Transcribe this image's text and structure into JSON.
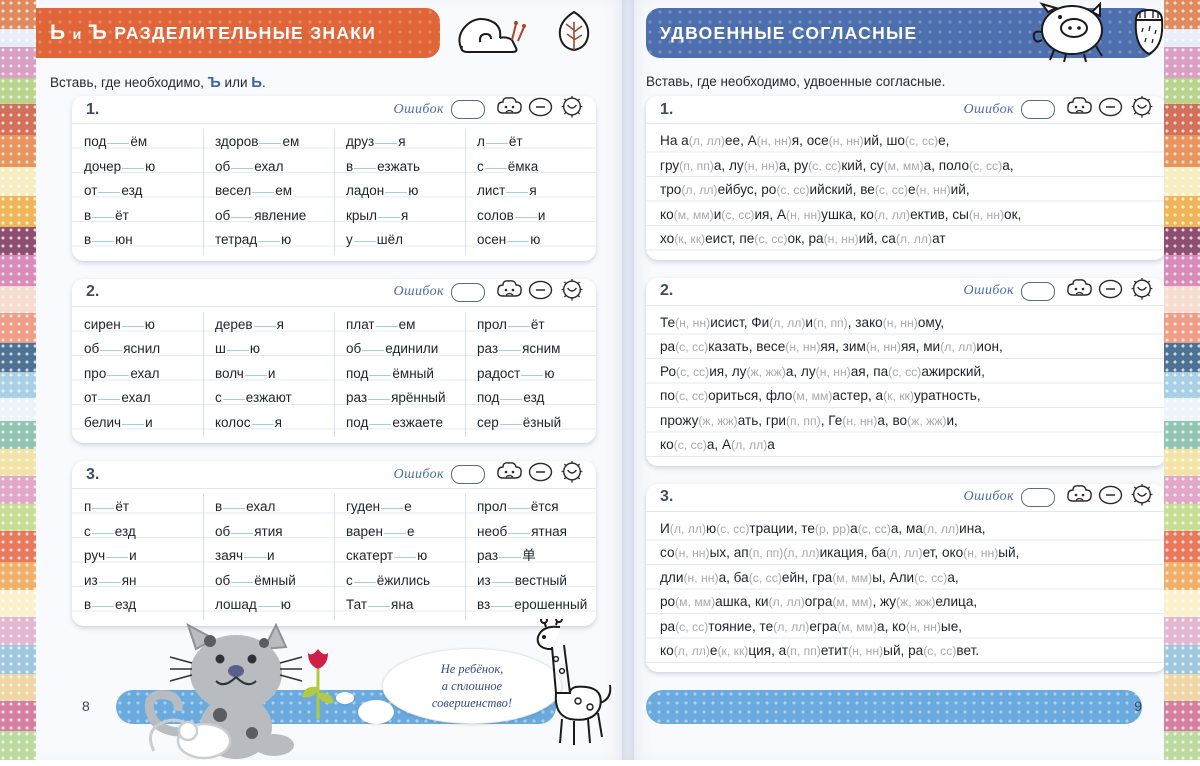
{
  "colors": {
    "left_banner": "#e0663a",
    "right_banner": "#4e6fae",
    "footer_bar": "#6aaade",
    "gap_underline": "#9fd0dd",
    "option_gray": "#a8a8ac",
    "accent_blue": "#3a63a8"
  },
  "border_bands": [
    {
      "color": "#e08a5e",
      "h": 28
    },
    {
      "color": "#e8eef7",
      "h": 18
    },
    {
      "color": "#d9a0c4",
      "h": 30
    },
    {
      "color": "#b9d48c",
      "h": 26
    },
    {
      "color": "#d4705a",
      "h": 30
    },
    {
      "color": "#e8945c",
      "h": 32
    },
    {
      "color": "#f7eec2",
      "h": 28
    },
    {
      "color": "#eeb659",
      "h": 30
    },
    {
      "color": "#8e5070",
      "h": 28
    },
    {
      "color": "#d98cba",
      "h": 30
    },
    {
      "color": "#f6ddd0",
      "h": 26
    },
    {
      "color": "#ef9d86",
      "h": 30
    },
    {
      "color": "#4c7193",
      "h": 28
    },
    {
      "color": "#a8cfe4",
      "h": 26
    },
    {
      "color": "#eef3f9",
      "h": 22
    },
    {
      "color": "#93c3b2",
      "h": 28
    },
    {
      "color": "#f3e3a8",
      "h": 26
    },
    {
      "color": "#e0a7c6",
      "h": 28
    },
    {
      "color": "#c9dd95",
      "h": 26
    },
    {
      "color": "#e8795c",
      "h": 30
    },
    {
      "color": "#f1b06a",
      "h": 28
    },
    {
      "color": "#fbf1cd",
      "h": 26
    },
    {
      "color": "#e3b7cf",
      "h": 28
    },
    {
      "color": "#9fc7e0",
      "h": 28
    },
    {
      "color": "#f0d6a6",
      "h": 26
    },
    {
      "color": "#d47f9f",
      "h": 30
    },
    {
      "color": "#bcd9a0",
      "h": 28
    }
  ],
  "left_page": {
    "banner": {
      "prefix": "Ь",
      "conj": "и",
      "prefix2": "Ъ",
      "title": "РАЗДЕЛИТЕЛЬНЫЕ ЗНАКИ",
      "icons": [
        "snail-icon",
        "leaf-icon"
      ]
    },
    "instruction": {
      "pre": "Вставь, где необходимо, ",
      "b1": "Ъ",
      "mid": " или ",
      "b2": "Ь",
      "post": "."
    },
    "error_label": "Ошибок",
    "mood_icons": [
      "sad-cloud-icon",
      "neutral-face-icon",
      "happy-sun-icon"
    ],
    "page_number": "8",
    "exercises": [
      {
        "num": "1.",
        "columns": [
          [
            {
              "a": "под",
              "b": "ём"
            },
            {
              "a": "дочер",
              "b": "ю"
            },
            {
              "a": "от",
              "b": "езд"
            },
            {
              "a": "в",
              "b": "ёт"
            },
            {
              "a": "в",
              "b": "юн"
            }
          ],
          [
            {
              "a": "здоров",
              "b": "ем"
            },
            {
              "a": "об",
              "b": "ехал"
            },
            {
              "a": "весел",
              "b": "ем"
            },
            {
              "a": "об",
              "b": "явление"
            },
            {
              "a": "тетрад",
              "b": "ю"
            }
          ],
          [
            {
              "a": "друз",
              "b": "я"
            },
            {
              "a": "в",
              "b": "езжать"
            },
            {
              "a": "ладон",
              "b": "ю"
            },
            {
              "a": "крыл",
              "b": "я"
            },
            {
              "a": "у",
              "b": "шёл"
            }
          ],
          [
            {
              "a": "л",
              "b": "ёт"
            },
            {
              "a": "с",
              "b": "ёмка"
            },
            {
              "a": "лист",
              "b": "я"
            },
            {
              "a": "солов",
              "b": "и"
            },
            {
              "a": "осен",
              "b": "ю"
            }
          ]
        ]
      },
      {
        "num": "2.",
        "columns": [
          [
            {
              "a": "сирен",
              "b": "ю"
            },
            {
              "a": "об",
              "b": "яснил"
            },
            {
              "a": "про",
              "b": "ехал"
            },
            {
              "a": "от",
              "b": "ехал"
            },
            {
              "a": "белич",
              "b": "и"
            }
          ],
          [
            {
              "a": "дерев",
              "b": "я"
            },
            {
              "a": "ш",
              "b": "ю"
            },
            {
              "a": "волч",
              "b": "и"
            },
            {
              "a": "с",
              "b": "езжают"
            },
            {
              "a": "колос",
              "b": "я"
            }
          ],
          [
            {
              "a": "плат",
              "b": "ем"
            },
            {
              "a": "об",
              "b": "единили"
            },
            {
              "a": "под",
              "b": "ёмный"
            },
            {
              "a": "раз",
              "b": "ярённый"
            },
            {
              "a": "под",
              "b": "езжаете"
            }
          ],
          [
            {
              "a": "прол",
              "b": "ёт"
            },
            {
              "a": "раз",
              "b": "ясним"
            },
            {
              "a": "радост",
              "b": "ю"
            },
            {
              "a": "под",
              "b": "езд"
            },
            {
              "a": "сер",
              "b": "ёзный"
            }
          ]
        ]
      },
      {
        "num": "3.",
        "columns": [
          [
            {
              "a": "п",
              "b": "ёт"
            },
            {
              "a": "с",
              "b": "езд"
            },
            {
              "a": "руч",
              "b": "и"
            },
            {
              "a": "из",
              "b": "ян"
            },
            {
              "a": "в",
              "b": "езд"
            }
          ],
          [
            {
              "a": "в",
              "b": "ехал"
            },
            {
              "a": "об",
              "b": "ятия"
            },
            {
              "a": "заяч",
              "b": "и"
            },
            {
              "a": "об",
              "b": "ёмный"
            },
            {
              "a": "лошад",
              "b": "ю"
            }
          ],
          [
            {
              "a": "гуден",
              "b": "е"
            },
            {
              "a": "варен",
              "b": "е"
            },
            {
              "a": "скатерт",
              "b": "ю"
            },
            {
              "a": "с",
              "b": "ёжились"
            },
            {
              "a": "Тат",
              "b": "яна"
            }
          ],
          [
            {
              "a": "прол",
              "b": "ётся"
            },
            {
              "a": "необ",
              "b": "ятная"
            },
            {
              "a": "раз",
              "b": "单"
            },
            {
              "a": "из",
              "b": "вестный"
            },
            {
              "a": "вз",
              "b": "ерошенный"
            }
          ]
        ]
      }
    ],
    "speech_bubble": [
      "Не ребёнок,",
      "а сплошное",
      "совершенство!"
    ],
    "illustrations": [
      "cat-illustration",
      "giraffe-illustration",
      "mouse-illustration",
      "tulip-illustration"
    ]
  },
  "right_page": {
    "banner": {
      "title": "УДВОЕННЫЕ СОГЛАСНЫЕ",
      "icons": [
        "pig-icon",
        "acorn-icon"
      ]
    },
    "instruction": "Вставь, где необходимо, удвоенные согласные.",
    "error_label": "Ошибок",
    "mood_icons": [
      "sad-cloud-icon",
      "neutral-face-icon",
      "happy-sun-icon"
    ],
    "page_number": "9",
    "exercises": [
      {
        "num": "1.",
        "lines": [
          [
            {
              "t": "На а"
            },
            {
              "o": "(л, лл)"
            },
            {
              "t": "ее, А"
            },
            {
              "o": "(н, нн)"
            },
            {
              "t": "я, осе"
            },
            {
              "o": "(н, нн)"
            },
            {
              "t": "ий, шо"
            },
            {
              "o": "(с, сс)"
            },
            {
              "t": "е,"
            }
          ],
          [
            {
              "t": "гру"
            },
            {
              "o": "(п, пп)"
            },
            {
              "t": "а, лу"
            },
            {
              "o": "(н, нн)"
            },
            {
              "t": "а, ру"
            },
            {
              "o": "(с, сс)"
            },
            {
              "t": "кий, су"
            },
            {
              "o": "(м, мм)"
            },
            {
              "t": "а, поло"
            },
            {
              "o": "(с, сс)"
            },
            {
              "t": "а,"
            }
          ],
          [
            {
              "t": "тро"
            },
            {
              "o": "(л, лл)"
            },
            {
              "t": "ейбус, ро"
            },
            {
              "o": "(с, сс)"
            },
            {
              "t": "ийский, ве"
            },
            {
              "o": "(с, сс)"
            },
            {
              "t": "е"
            },
            {
              "o": "(н, нн)"
            },
            {
              "t": "ий,"
            }
          ],
          [
            {
              "t": "ко"
            },
            {
              "o": "(м, мм)"
            },
            {
              "t": "и"
            },
            {
              "o": "(с, сс)"
            },
            {
              "t": "ия, А"
            },
            {
              "o": "(н, нн)"
            },
            {
              "t": "ушка, ко"
            },
            {
              "o": "(л, лл)"
            },
            {
              "t": "ектив, сы"
            },
            {
              "o": "(н, нн)"
            },
            {
              "t": "ок,"
            }
          ],
          [
            {
              "t": "хо"
            },
            {
              "o": "(к, кк)"
            },
            {
              "t": "еист, пе"
            },
            {
              "o": "(с, сс)"
            },
            {
              "t": "ок, ра"
            },
            {
              "o": "(н, нн)"
            },
            {
              "t": "ий, са"
            },
            {
              "o": "(л, лл)"
            },
            {
              "t": "ат"
            }
          ]
        ]
      },
      {
        "num": "2.",
        "lines": [
          [
            {
              "t": "Те"
            },
            {
              "o": "(н, нн)"
            },
            {
              "t": "исист, Фи"
            },
            {
              "o": "(л, лл)"
            },
            {
              "t": "и"
            },
            {
              "o": "(п, пп)"
            },
            {
              "t": ", зако"
            },
            {
              "o": "(н, нн)"
            },
            {
              "t": "ому,"
            }
          ],
          [
            {
              "t": "ра"
            },
            {
              "o": "(с, сс)"
            },
            {
              "t": "казать, весе"
            },
            {
              "o": "(н, нн)"
            },
            {
              "t": "яя, зим"
            },
            {
              "o": "(н, нн)"
            },
            {
              "t": "яя, ми"
            },
            {
              "o": "(л, лл)"
            },
            {
              "t": "ион,"
            }
          ],
          [
            {
              "t": "Ро"
            },
            {
              "o": "(с, сс)"
            },
            {
              "t": "ия, лу"
            },
            {
              "o": "(ж, жж)"
            },
            {
              "t": "а, лу"
            },
            {
              "o": "(н, нн)"
            },
            {
              "t": "ая, па"
            },
            {
              "o": "(с, сс)"
            },
            {
              "t": "ажирский,"
            }
          ],
          [
            {
              "t": "по"
            },
            {
              "o": "(с, сс)"
            },
            {
              "t": "ориться, фло"
            },
            {
              "o": "(м, мм)"
            },
            {
              "t": "астер, а"
            },
            {
              "o": "(к, кк)"
            },
            {
              "t": "уратность,"
            }
          ],
          [
            {
              "t": "прожу"
            },
            {
              "o": "(ж, жж)"
            },
            {
              "t": "ать, гри"
            },
            {
              "o": "(п, пп)"
            },
            {
              "t": ", Ге"
            },
            {
              "o": "(н, нн)"
            },
            {
              "t": "а, во"
            },
            {
              "o": "(ж, жж)"
            },
            {
              "t": "и,"
            }
          ],
          [
            {
              "t": "ко"
            },
            {
              "o": "(с, сс)"
            },
            {
              "t": "а, А"
            },
            {
              "o": "(л, лл)"
            },
            {
              "t": "а"
            }
          ]
        ]
      },
      {
        "num": "3.",
        "lines": [
          [
            {
              "t": "И"
            },
            {
              "o": "(л, лл)"
            },
            {
              "t": "ю"
            },
            {
              "o": "(с, сс)"
            },
            {
              "t": "трации, те"
            },
            {
              "o": "(р, рр)"
            },
            {
              "t": "а"
            },
            {
              "o": "(с, сс)"
            },
            {
              "t": "а, ма"
            },
            {
              "o": "(л, лл)"
            },
            {
              "t": "ина,"
            }
          ],
          [
            {
              "t": "со"
            },
            {
              "o": "(н, нн)"
            },
            {
              "t": "ых, ап"
            },
            {
              "o": "(п, пп)"
            },
            {
              "o2": "(л, лл)"
            },
            {
              "t": "икация, ба"
            },
            {
              "o": "(л, лл)"
            },
            {
              "t": "ет, око"
            },
            {
              "o": "(н, нн)"
            },
            {
              "t": "ый,"
            }
          ],
          [
            {
              "t": "дли"
            },
            {
              "o": "(н, нн)"
            },
            {
              "t": "а, ба"
            },
            {
              "o": "(с, сс)"
            },
            {
              "t": "ейн, гра"
            },
            {
              "o": "(м, мм)"
            },
            {
              "t": "ы, Али"
            },
            {
              "o": "(с, сс)"
            },
            {
              "t": "а,"
            }
          ],
          [
            {
              "t": "ро"
            },
            {
              "o": "(м, мм)"
            },
            {
              "t": "ашка, ки"
            },
            {
              "o": "(л, лл)"
            },
            {
              "t": "огра"
            },
            {
              "o": "(м, мм)"
            },
            {
              "t": ", жу"
            },
            {
              "o": "(ж, жж)"
            },
            {
              "t": "елица,"
            }
          ],
          [
            {
              "t": "ра"
            },
            {
              "o": "(с, сс)"
            },
            {
              "t": "тояние, те"
            },
            {
              "o": "(л, лл)"
            },
            {
              "t": "егра"
            },
            {
              "o": "(м, мм)"
            },
            {
              "t": "а, ко"
            },
            {
              "o": "(н, нн)"
            },
            {
              "t": "ые,"
            }
          ],
          [
            {
              "t": "ко"
            },
            {
              "o": "(л, лл)"
            },
            {
              "t": "е"
            },
            {
              "o": "(к, кк)"
            },
            {
              "t": "ция, а"
            },
            {
              "o": "(п, пп)"
            },
            {
              "t": "етит"
            },
            {
              "o": "(н, нн)"
            },
            {
              "t": "ый, ра"
            },
            {
              "o": "(с, сс)"
            },
            {
              "t": "вет."
            }
          ]
        ]
      }
    ]
  }
}
